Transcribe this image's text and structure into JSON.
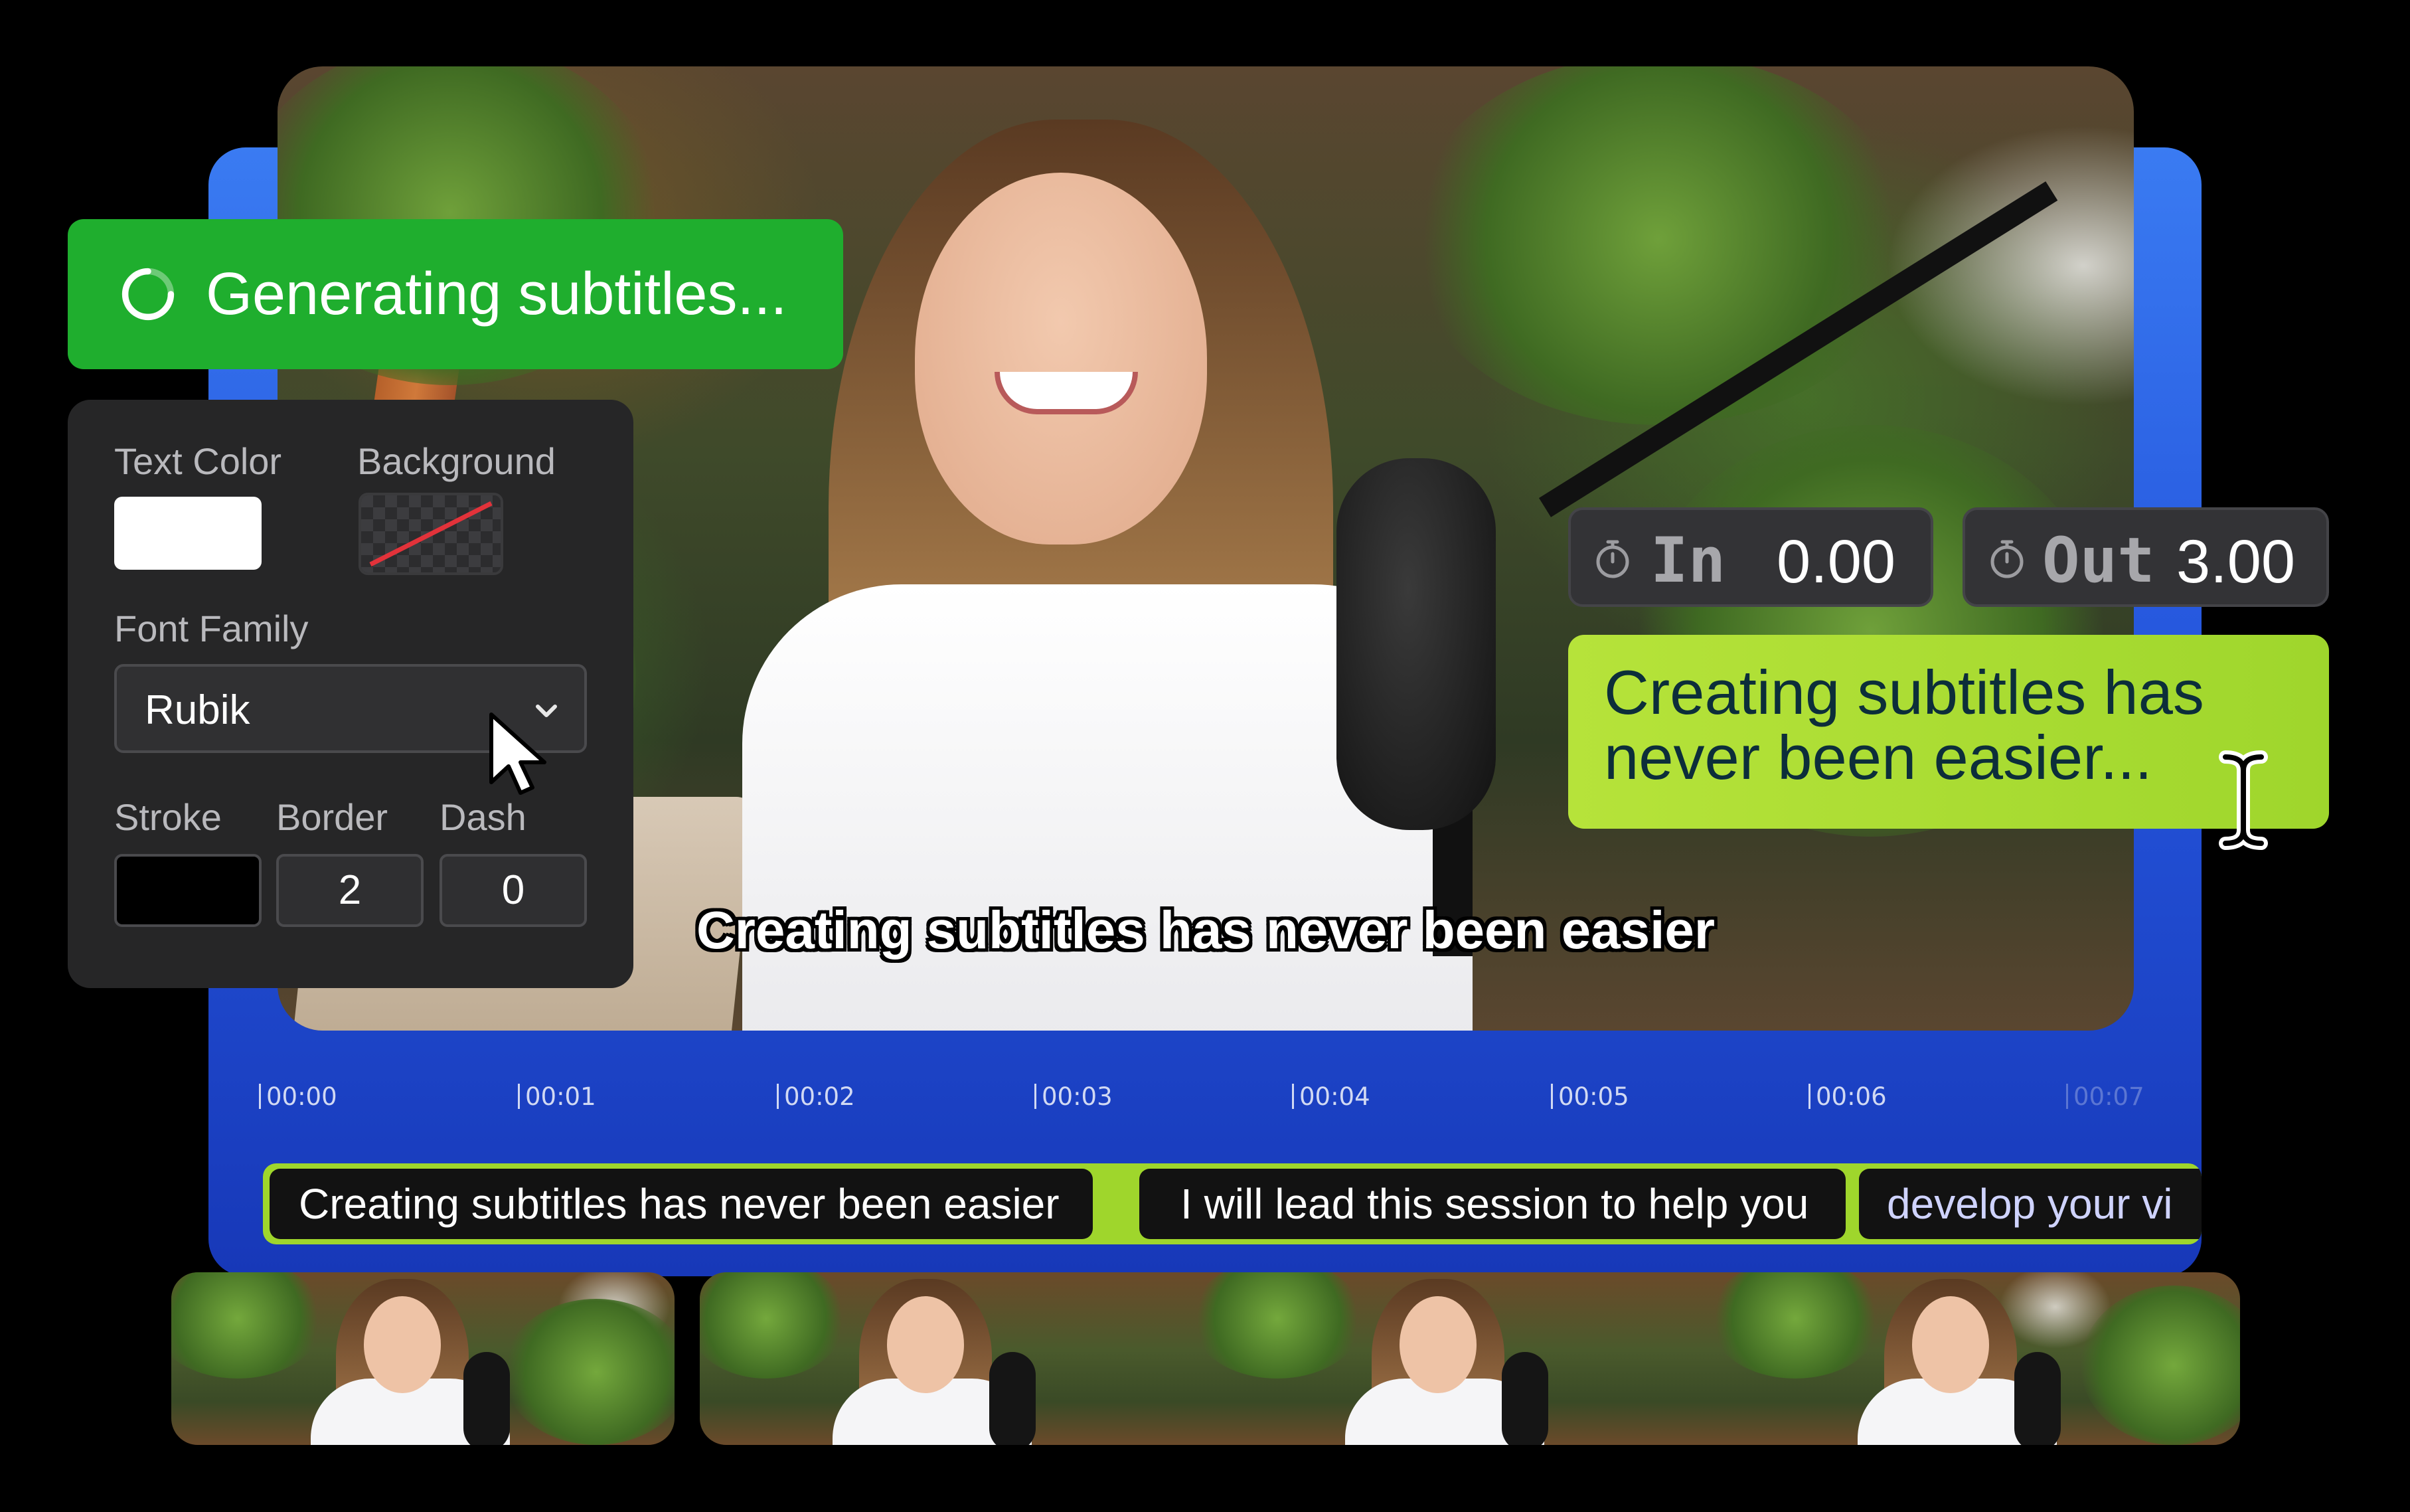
{
  "status_banner": {
    "text": "Generating subtitles..."
  },
  "style_panel": {
    "text_color_label": "Text Color",
    "text_color_value": "#FFFFFF",
    "background_label": "Background",
    "background_value": "none",
    "font_family_label": "Font Family",
    "font_family_value": "Rubik",
    "stroke_label": "Stroke",
    "stroke_color": "#000000",
    "border_label": "Border",
    "border_value": "2",
    "dash_label": "Dash",
    "dash_value": "0"
  },
  "timing": {
    "in_label": "In",
    "in_value": "0.00",
    "out_label": "Out",
    "out_value": "3.00"
  },
  "caption_editor": {
    "text": "Creating subtitles has never been easier..."
  },
  "video": {
    "subtitle": "Creating subtitles has never been easier"
  },
  "timeline": {
    "ruler": [
      "00:00",
      "00:01",
      "00:02",
      "00:03",
      "00:04",
      "00:05",
      "00:06",
      "00:07"
    ],
    "clips": [
      "Creating subtitles has never been easier",
      "I will lead this session to help you",
      "develop your vi"
    ]
  },
  "icons": {
    "spinner": "loading-spinner-icon",
    "stopwatch": "stopwatch-icon",
    "chevron": "chevron-down-icon",
    "cursor": "mouse-pointer-icon",
    "text_cursor": "i-beam-cursor-icon"
  },
  "colors": {
    "banner_green": "#1FAE2E",
    "caption_lime": "#A8DC32",
    "editor_blue": "#2A5FE6"
  }
}
